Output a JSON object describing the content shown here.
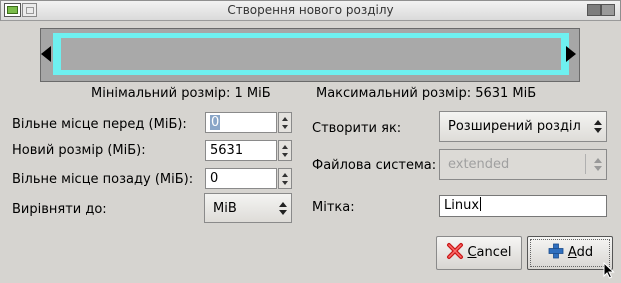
{
  "window": {
    "title": "Створення нового розділу"
  },
  "partition": {
    "min_size_text": "Мінімальний розмір: 1 МіБ",
    "max_size_text": "Максимальний розмір: 5631 МіБ",
    "fill_fraction": 1.0
  },
  "fields": {
    "free_before_label": "Вільне місце перед (МіБ):",
    "free_before_value": "0",
    "new_size_label": "Новий розмір (МіБ):",
    "new_size_value": "5631",
    "free_after_label": "Вільне місце позаду (МіБ):",
    "free_after_value": "0",
    "align_label": "Вирівняти до:",
    "align_value": "MiB",
    "create_as_label": "Створити як:",
    "create_as_value": "Розширений розділ",
    "filesystem_label": "Файлова система:",
    "filesystem_value": "extended",
    "tag_label": "Мітка:",
    "tag_value": "Linux"
  },
  "buttons": {
    "cancel_mnemonic": "C",
    "cancel_rest": "ancel",
    "add_mnemonic": "A",
    "add_rest": "dd"
  },
  "icons": {
    "window": "app-icon",
    "cancel": "cancel-icon",
    "add": "add-icon"
  }
}
